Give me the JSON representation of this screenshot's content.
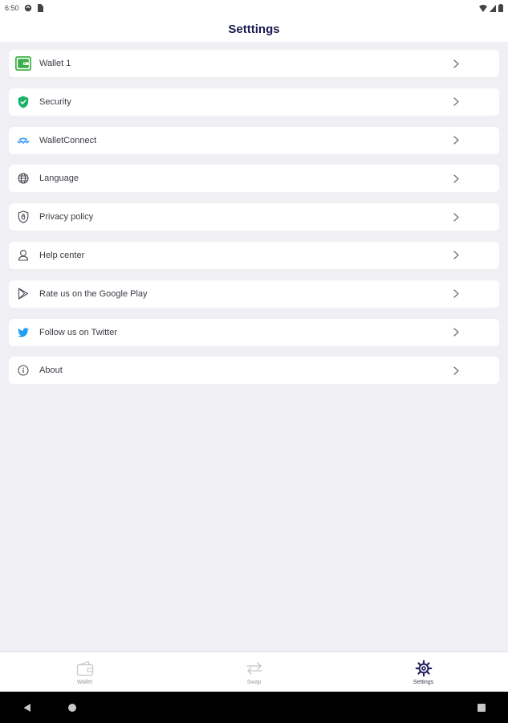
{
  "status_bar": {
    "time": "6:50"
  },
  "header": {
    "title": "Setttings"
  },
  "settings": [
    {
      "key": "wallet",
      "label": "Wallet 1",
      "icon": "wallet-green-icon"
    },
    {
      "key": "security",
      "label": "Security",
      "icon": "shield-green-icon"
    },
    {
      "key": "walletconnect",
      "label": "WalletConnect",
      "icon": "walletconnect-icon"
    },
    {
      "key": "language",
      "label": "Language",
      "icon": "globe-icon"
    },
    {
      "key": "privacy",
      "label": "Privacy policy",
      "icon": "shield-outline-icon"
    },
    {
      "key": "help",
      "label": "Help center",
      "icon": "person-icon"
    },
    {
      "key": "rate",
      "label": "Rate us on the Google Play",
      "icon": "play-store-icon"
    },
    {
      "key": "twitter",
      "label": "Follow us on Twitter",
      "icon": "twitter-icon"
    },
    {
      "key": "about",
      "label": "About",
      "icon": "info-icon"
    }
  ],
  "bottom_nav": {
    "tabs": [
      {
        "label": "Wallet",
        "icon": "wallet-icon",
        "active": false
      },
      {
        "label": "Swap",
        "icon": "swap-icon",
        "active": false
      },
      {
        "label": "Settings",
        "icon": "gear-icon",
        "active": true
      }
    ]
  },
  "colors": {
    "background": "#efeff4",
    "title": "#1c1a4f",
    "accent_green": "#3fae49",
    "walletconnect_blue": "#3b99fc",
    "twitter_blue": "#1da1f2"
  }
}
